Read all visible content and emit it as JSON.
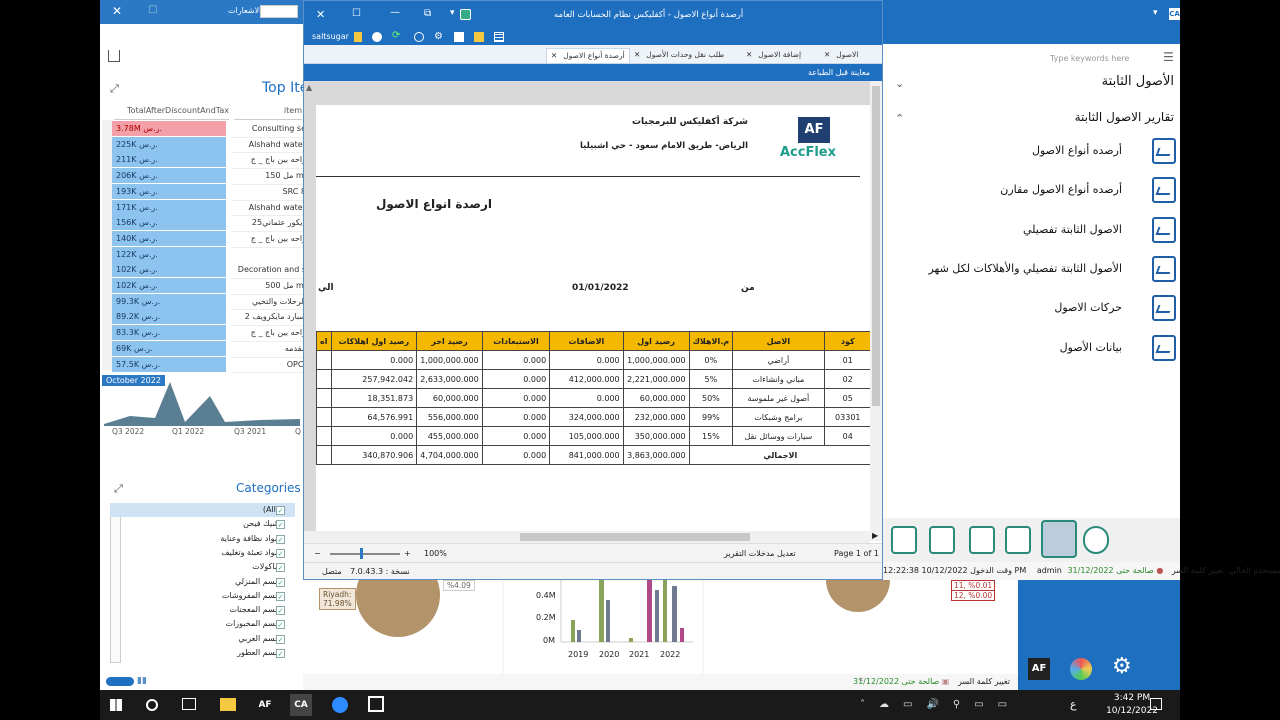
{
  "background_app": {
    "notifications_label": "الاشعارات",
    "top_items_title": "Top Ite",
    "col_total": "TotalAfterDiscountAndTax",
    "col_item": "item",
    "rows": [
      {
        "value": "3.78M ر.س.",
        "item": "Consulting se",
        "highlight": true
      },
      {
        "value": "225K ر.س.",
        "item": "Alshahd water"
      },
      {
        "value": "211K ر.س.",
        "item": "راحه بين باج _ ج"
      },
      {
        "value": "206K ر.س.",
        "item": "مل 150 ml"
      },
      {
        "value": "193K ر.س.",
        "item": "SRC 8"
      },
      {
        "value": "171K ر.س.",
        "item": "Alshahd water"
      },
      {
        "value": "156K ر.س.",
        "item": "ديكور عثماني25"
      },
      {
        "value": "140K ر.س.",
        "item": "راحه بين باج _ ج"
      },
      {
        "value": "122K ر.س.",
        "item": ""
      },
      {
        "value": "102K ر.س.",
        "item": "Decoration and s"
      },
      {
        "value": "102K ر.س.",
        "item": "مل 500 ml"
      },
      {
        "value": "99.3K ر.س.",
        "item": "الرحلات والتخيي"
      },
      {
        "value": "89.2K ر.س.",
        "item": "سبارد مايكرويف 2"
      },
      {
        "value": "83.3K ر.س.",
        "item": "راحه بين باج _ ج"
      },
      {
        "value": "69K ر.س.",
        "item": "مقدمه"
      },
      {
        "value": "57.5K ر.س.",
        "item": "OPC."
      }
    ],
    "mini_chart_label": "October 2022",
    "mini_chart_ticks": [
      "Q3 2022",
      "Q1 2022",
      "Q3 2021",
      "Q"
    ],
    "categories_title": "Categories",
    "categories": [
      "(All)",
      "شيك فيحن",
      "مواد نظافة وعناية",
      "مواد تعبئة وتغليف",
      "ماكولات",
      "قسم المنزلي",
      "قسم المفروشات",
      "قسم المعجنات",
      "قسم المخبوزات",
      "قسم العربي",
      "قسم العطور"
    ],
    "pie_label": "Riyadh:\n71.98%",
    "pie_label2": "%4.09",
    "bar_yticks": [
      "0.4M",
      "0.2M",
      "0M"
    ],
    "bar_xticks": [
      "2019",
      "2020",
      "2021",
      "2022"
    ],
    "side_values": [
      "11, %0.01",
      "12, %0.00"
    ]
  },
  "report_window": {
    "title": "أرصدة أنواع الاصول - أكفليكس نظام الحسابات العامه",
    "user_chip": "saltsugar",
    "tabs": [
      "الاصول",
      "إضافة الاصول",
      "طلب نقل وحدات الأصول",
      "أرصدة أنواع الاصول"
    ],
    "bar_title": "معاينة قبل الطباعة",
    "company_name": "شركة أكفليكس للبرمجيات",
    "company_address": "الرياض- طريق الامام سعود - حي اشبيليا",
    "logo_text": "AccFlex",
    "logo_badge": "AF",
    "report_title": "ارصدة انواع الاصول",
    "from_label": "من",
    "from_date": "01/01/2022",
    "to_label": "الي",
    "headers": [
      "كود",
      "الاصل",
      "م.الاهلاك",
      "رصيد اول",
      "الاضافات",
      "الاستبعادات",
      "رصيد اخر",
      "رصيد اول اهلاكات",
      "اه"
    ],
    "rows": [
      {
        "code": "01",
        "asset": "أراضي",
        "rate": "0%",
        "opening": "1,000,000.000",
        "additions": "0.000",
        "disposals": "0.000",
        "closing": "1,000,000.000",
        "dep_open": "0.000"
      },
      {
        "code": "02",
        "asset": "مباني وانشاءات",
        "rate": "5%",
        "opening": "2,221,000.000",
        "additions": "412,000.000",
        "disposals": "0.000",
        "closing": "2,633,000.000",
        "dep_open": "257,942.042"
      },
      {
        "code": "05",
        "asset": "أصول غير ملموسة",
        "rate": "50%",
        "opening": "60,000.000",
        "additions": "0.000",
        "disposals": "0.000",
        "closing": "60,000.000",
        "dep_open": "18,351.873"
      },
      {
        "code": "03301",
        "asset": "برامج وشبكات",
        "rate": "99%",
        "opening": "232,000.000",
        "additions": "324,000.000",
        "disposals": "0.000",
        "closing": "556,000.000",
        "dep_open": "64,576.991"
      },
      {
        "code": "04",
        "asset": "سيارات ووسائل نقل",
        "rate": "15%",
        "opening": "350,000.000",
        "additions": "105,000.000",
        "disposals": "0.000",
        "closing": "455,000.000",
        "dep_open": "0.000"
      }
    ],
    "total_label": "الاجمالي",
    "totals": {
      "opening": "3,863,000.000",
      "additions": "841,000.000",
      "disposals": "0.000",
      "closing": "4,704,000.000",
      "dep_open": "340,870.906"
    },
    "zoom": "100%",
    "edit_inputs": "تعديل مدخلات التقرير",
    "page_info": "Page 1 of 1",
    "version": "نسخة : 7.0.43.3",
    "connection": "متصل"
  },
  "nav": {
    "search_placeholder": "Type keywords here",
    "section_title": "الأصول الثابتة",
    "subsection_title": "تقارير الاصول الثابتة",
    "items": [
      "أرصده أنواع الاصول",
      "أرصده أنواع الاصول مقارن",
      "الاصول الثابتة تفصيلي",
      "الأصول الثابتة تفصيلي والأهلاكات لكل شهر",
      "حركات الاصول",
      "بيانات الأصول"
    ],
    "status_valid": "صالحة حتى 31/12/2022",
    "status_change_pw": "تغيير كلمة السر",
    "status_user_label": "المستخدم الحالي",
    "status_user": "admin",
    "status_login": "وقت الدخول 10/12/2022 12:22:38 PM"
  },
  "bottom_status": {
    "valid": "صالحة حتى 31/12/2022",
    "change_pw": "تغيير كلمة السر"
  },
  "taskbar": {
    "time": "3:42 PM",
    "date": "10/12/2022",
    "lang": "ع"
  },
  "colors": {
    "accent": "#1e6fc0",
    "header_gold": "#f5b800",
    "highlight_row": "#f4a0a8",
    "value_cell": "#8cc4ef"
  }
}
